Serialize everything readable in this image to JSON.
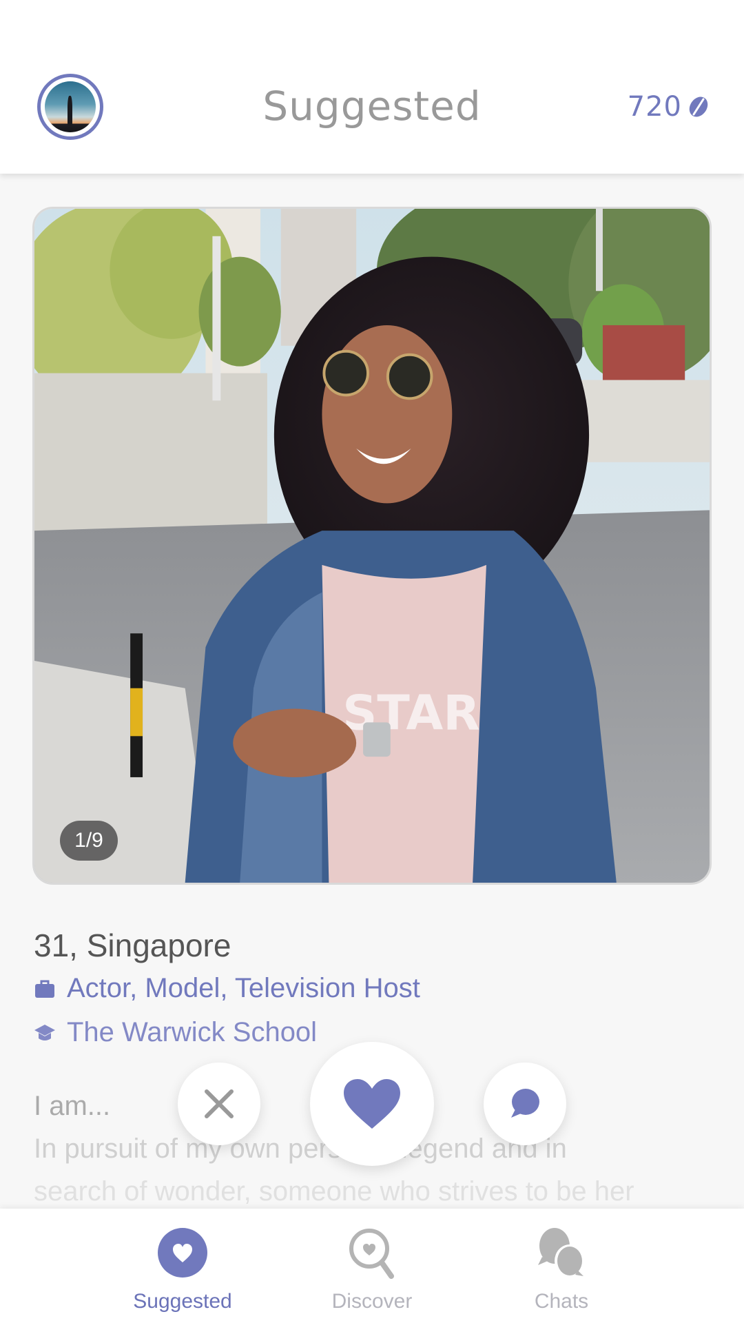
{
  "colors": {
    "accent": "#7179bd",
    "title_gray": "#999999",
    "inactive_gray": "#b4b4bc",
    "background": "#f7f7f7"
  },
  "header": {
    "title": "Suggested",
    "avatar_icon": "profile-avatar",
    "credits": {
      "value": "720",
      "icon": "coffee-bean-icon"
    }
  },
  "profile": {
    "photo_counter": "1/9",
    "photo_index": 1,
    "photo_total": 9,
    "age_location": "31, Singapore",
    "occupation": {
      "icon": "briefcase-icon",
      "text": "Actor, Model, Television Host"
    },
    "school": {
      "icon": "graduation-cap-icon",
      "text": "The Warwick School"
    },
    "about_title": "I am...",
    "bio_lines": [
      "In pursuit of my own personal legend and in",
      "search of wonder, someone who strives to be her"
    ]
  },
  "actions": [
    {
      "name": "pass",
      "icon": "close-icon"
    },
    {
      "name": "like",
      "icon": "heart-icon"
    },
    {
      "name": "chat",
      "icon": "chat-bubble-icon"
    }
  ],
  "bottom_nav": {
    "items": [
      {
        "label": "Suggested",
        "icon": "heart-circle-icon",
        "active": true
      },
      {
        "label": "Discover",
        "icon": "search-heart-icon",
        "active": false
      },
      {
        "label": "Chats",
        "icon": "chats-icon",
        "active": false
      }
    ]
  }
}
